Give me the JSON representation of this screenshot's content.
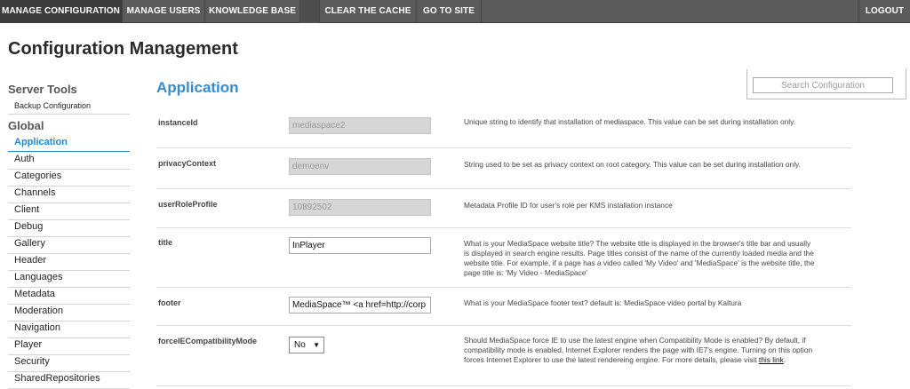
{
  "topnav": {
    "manage_configuration": "MANAGE CONFIGURATION",
    "manage_users": "MANAGE USERS",
    "knowledge_base": "KNOWLEDGE BASE",
    "clear_cache": "CLEAR THE CACHE",
    "go_to_site": "GO TO SITE",
    "logout": "LOGOUT"
  },
  "page_title": "Configuration Management",
  "sidebar": {
    "server_tools_heading": "Server Tools",
    "backup_configuration": "Backup Configuration",
    "global_heading": "Global",
    "items": [
      "Application",
      "Auth",
      "Categories",
      "Channels",
      "Client",
      "Debug",
      "Gallery",
      "Header",
      "Languages",
      "Metadata",
      "Moderation",
      "Navigation",
      "Player",
      "Security",
      "SharedRepositories"
    ]
  },
  "section_title": "Application",
  "search": {
    "placeholder": "Search Configuration"
  },
  "fields": {
    "instanceId": {
      "label": "instanceId",
      "value": "mediaspace2",
      "desc": "Unique string to identify that installation of mediaspace. This value can be set during installation only."
    },
    "privacyContext": {
      "label": "privacyContext",
      "value": "demoenv",
      "desc": "String used to be set as privacy context on root category. This value can be set during installation only."
    },
    "userRoleProfile": {
      "label": "userRoleProfile",
      "value": "10892502",
      "desc": "Metadata Profile ID for user's role per KMS installation instance"
    },
    "title": {
      "label": "title",
      "value": "InPlayer",
      "desc": "What is your MediaSpace website title? The website title is displayed in the browser's title bar and usually is displayed in search engine results. Page titles consist of the name of the currently loaded media and the website title. For example, if a page has a video called 'My Video' and 'MediaSpace' is the website title, the page title is: 'My Video - MediaSpace'"
    },
    "footer": {
      "label": "footer",
      "value": "MediaSpace™ <a href=http://corp",
      "desc": "What is your MediaSpace footer text? default is: MediaSpace video portal by Kaltura"
    },
    "forceIECompatibilityMode": {
      "label": "forceIECompatibilityMode",
      "value": "No",
      "desc": "Should MediaSpace force IE to use the latest engine when Compatibility Mode is enabled? By default, if compatibility mode is enabled, Internet Explorer renders the page with IE7's engine. Turning on this option forces Internet Explorer to use the latest rendereing engine. For more details, please visit",
      "link": "this link",
      "desc_end": "."
    }
  },
  "icons": {
    "select_caret": "caret-down-icon"
  },
  "colors": {
    "nav_bg": "#5b5b5b",
    "accent": "#1f8ad6"
  }
}
